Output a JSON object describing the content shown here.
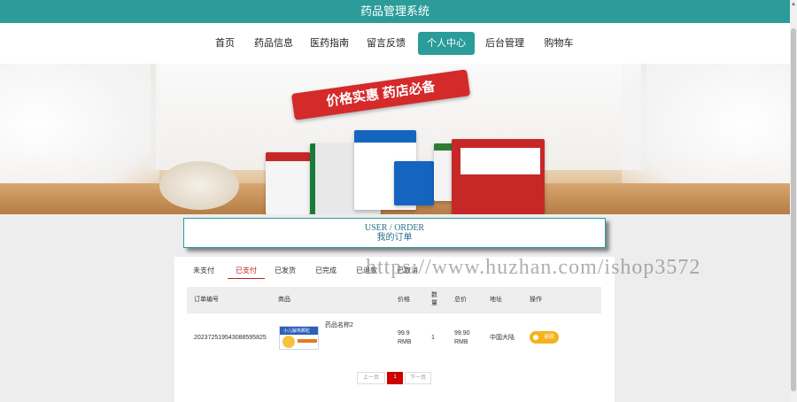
{
  "header": {
    "title": "药品管理系统"
  },
  "nav": {
    "items": [
      {
        "label": "首页"
      },
      {
        "label": "药品信息"
      },
      {
        "label": "医药指南"
      },
      {
        "label": "留言反馈"
      },
      {
        "label": "个人中心"
      },
      {
        "label": "后台管理"
      },
      {
        "label": "购物车"
      }
    ],
    "active": "个人中心"
  },
  "banner": {
    "slogan": "价格实惠 药店必备"
  },
  "order_section": {
    "title_en": "USER / ORDER",
    "title_cn": "我的订单"
  },
  "tabs": [
    {
      "label": "未支付"
    },
    {
      "label": "已支付"
    },
    {
      "label": "已发货"
    },
    {
      "label": "已完成"
    },
    {
      "label": "已退款"
    },
    {
      "label": "已取消"
    }
  ],
  "active_tab": "已支付",
  "table": {
    "headers": {
      "order_no": "订单编号",
      "product": "商品",
      "price": "价格",
      "qty": "数量",
      "total": "总价",
      "address": "地址",
      "action": "操作"
    },
    "rows": [
      {
        "order_no": "2023725195430885958​25",
        "product_name": "药品名称2",
        "product_image_text": "小儿解热颗粒",
        "price_value": "99.9",
        "price_unit": "RMB",
        "qty": "1",
        "total_value": "99.90",
        "total_unit": "RMB",
        "address": "中国大陆",
        "action": "退款"
      }
    ]
  },
  "pagination": {
    "prev": "上一页",
    "current": "1",
    "next": "下一页"
  },
  "watermark": "https://www.huzhan.com/ishop3572",
  "colors": {
    "primary": "#2b9c9a",
    "accent": "#c02020",
    "refund": "#f5b21c"
  }
}
